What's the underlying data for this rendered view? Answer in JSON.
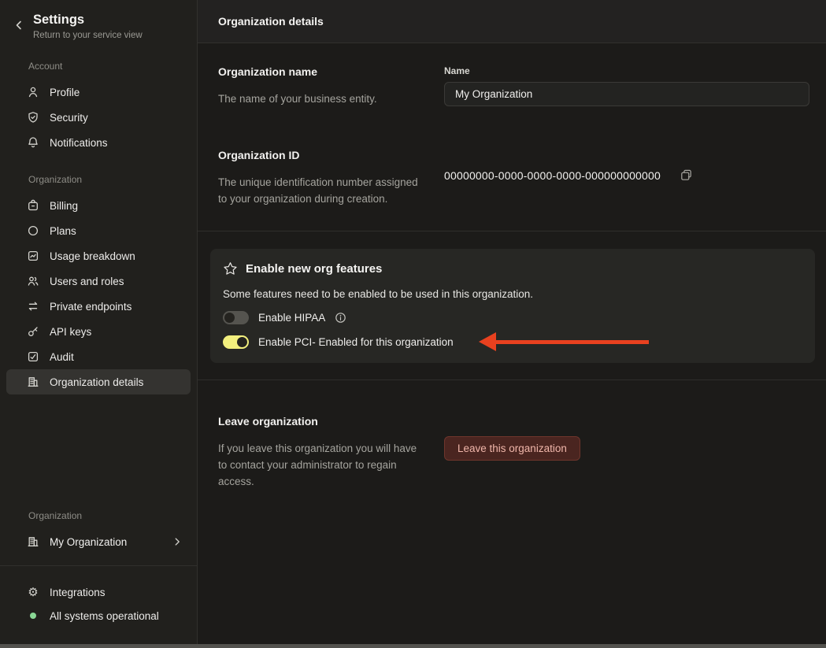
{
  "sidebar": {
    "title": "Settings",
    "subtitle": "Return to your service view",
    "account_label": "Account",
    "account_items": [
      {
        "label": "Profile",
        "icon": "person-icon"
      },
      {
        "label": "Security",
        "icon": "shield-check-icon"
      },
      {
        "label": "Notifications",
        "icon": "bell-icon"
      }
    ],
    "organization_label": "Organization",
    "organization_items": [
      {
        "label": "Billing",
        "icon": "wallet-icon"
      },
      {
        "label": "Plans",
        "icon": "circle-icon"
      },
      {
        "label": "Usage breakdown",
        "icon": "chart-icon"
      },
      {
        "label": "Users and roles",
        "icon": "users-icon"
      },
      {
        "label": "Private endpoints",
        "icon": "swap-arrows-icon"
      },
      {
        "label": "API keys",
        "icon": "key-icon"
      },
      {
        "label": "Audit",
        "icon": "audit-icon"
      },
      {
        "label": "Organization details",
        "icon": "building-icon",
        "active": true
      }
    ],
    "org_switcher_label": "Organization",
    "org_switcher_name": "My Organization",
    "integrations_label": "Integrations",
    "status_text": "All systems operational"
  },
  "main": {
    "header_title": "Organization details",
    "org_name": {
      "title": "Organization name",
      "description": "The name of your business entity.",
      "field_label": "Name",
      "field_value": "My Organization"
    },
    "org_id": {
      "title": "Organization ID",
      "description": "The unique identification number assigned to your organization during creation.",
      "value": "00000000-0000-0000-0000-000000000000"
    },
    "features_card": {
      "title": "Enable new org features",
      "description": "Some features need to be enabled to be used in this organization.",
      "toggles": [
        {
          "label": "Enable HIPAA",
          "state": "off",
          "has_info_icon": true
        },
        {
          "label": "Enable PCI- Enabled for this organization",
          "state": "on"
        }
      ]
    },
    "leave": {
      "title": "Leave organization",
      "description": "If you leave this organization you will have to contact your administrator to regain access.",
      "button_label": "Leave this organization"
    }
  },
  "colors": {
    "toggle_on_yellow": "#f2ef7e",
    "toggle_off_gray": "#55544f",
    "arrow_red": "#e8411f",
    "status_green": "#8ad795",
    "danger_bg": "#4a2520",
    "danger_border": "#6e352c",
    "danger_text": "#f0b6aa"
  }
}
